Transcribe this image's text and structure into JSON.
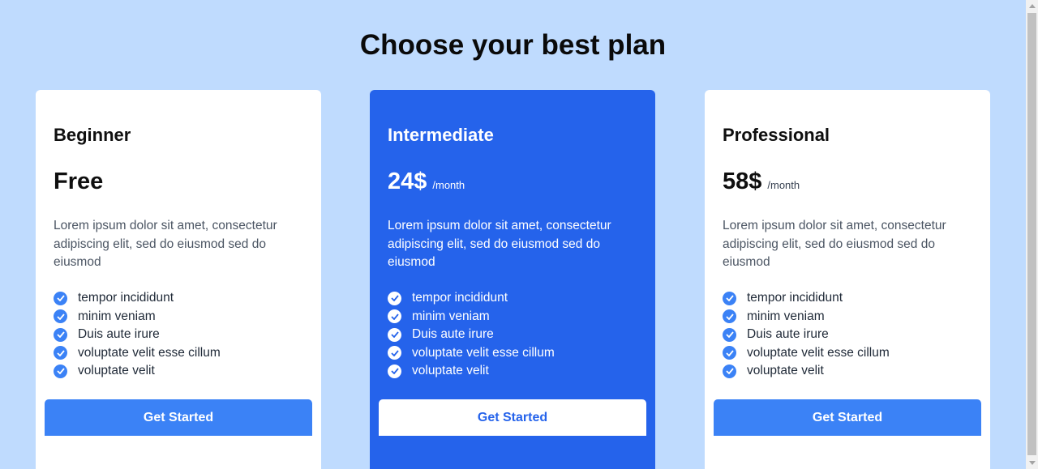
{
  "page": {
    "title": "Choose your best plan"
  },
  "plans": [
    {
      "name": "Beginner",
      "price": "Free",
      "period": "",
      "description": "Lorem ipsum dolor sit amet, consectetur adipiscing elit, sed do eiusmod sed do eiusmod",
      "features": [
        "tempor incididunt",
        "minim veniam",
        "Duis aute irure",
        "voluptate velit esse cillum",
        "voluptate velit"
      ],
      "cta": "Get Started",
      "highlighted": false
    },
    {
      "name": "Intermediate",
      "price": "24$",
      "period": "/month",
      "description": "Lorem ipsum dolor sit amet, consectetur adipiscing elit, sed do eiusmod sed do eiusmod",
      "features": [
        "tempor incididunt",
        "minim veniam",
        "Duis aute irure",
        "voluptate velit esse cillum",
        "voluptate velit"
      ],
      "cta": "Get Started",
      "highlighted": true
    },
    {
      "name": "Professional",
      "price": "58$",
      "period": "/month",
      "description": "Lorem ipsum dolor sit amet, consectetur adipiscing elit, sed do eiusmod sed do eiusmod",
      "features": [
        "tempor incididunt",
        "minim veniam",
        "Duis aute irure",
        "voluptate velit esse cillum",
        "voluptate velit"
      ],
      "cta": "Get Started",
      "highlighted": false
    }
  ],
  "icons": {
    "feature": "check-circle-icon",
    "scroll_up": "chevron-up-icon",
    "scroll_down": "chevron-down-icon"
  },
  "colors": {
    "background": "#bfdbfe",
    "card": "#ffffff",
    "highlight_card": "#2563eb",
    "accent": "#3b82f6",
    "text": "#0f0f0f",
    "muted_text": "#4b5563"
  }
}
